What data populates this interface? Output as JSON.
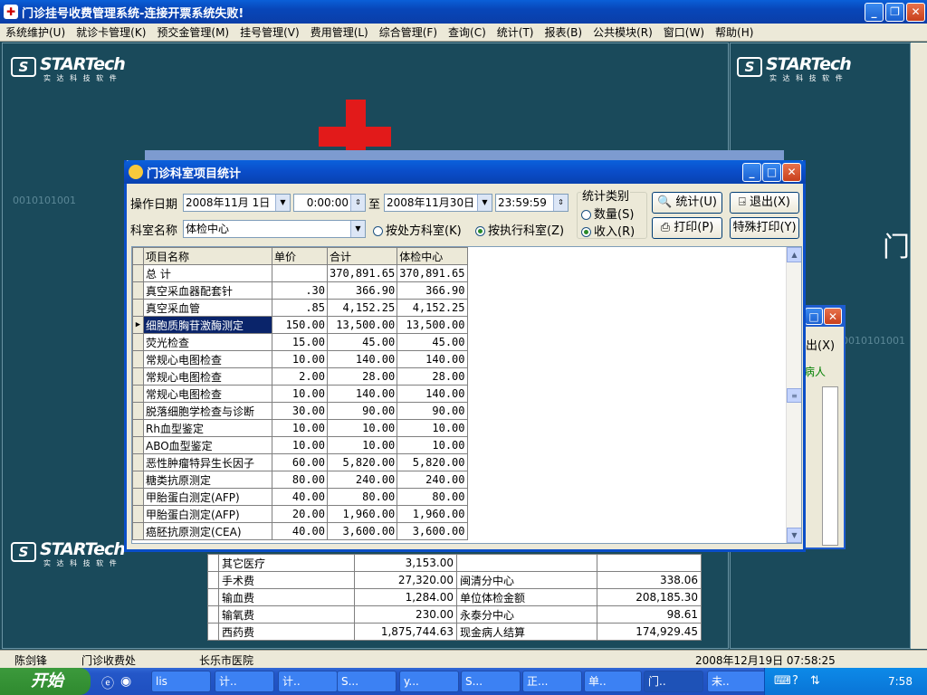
{
  "app": {
    "title": "门诊挂号收费管理系统-连接开票系统失败!",
    "menu": [
      "系统维护(U)",
      "就诊卡管理(K)",
      "预交金管理(M)",
      "挂号管理(V)",
      "费用管理(L)",
      "综合管理(F)",
      "查询(C)",
      "统计(T)",
      "报表(B)",
      "公共模块(R)",
      "窗口(W)",
      "帮助(H)"
    ],
    "logo_text": "STARTech",
    "logo_sub": "实 达 科 技 软 件",
    "bg_text": "门",
    "bg_binary": "0010101001"
  },
  "dialog": {
    "title": "门诊科室项目统计",
    "op_date_label": "操作日期",
    "date_from": "2008年11月 1日",
    "time_from": "0:00:00",
    "to_label": "至",
    "date_to": "2008年11月30日",
    "time_to": "23:59:59",
    "dept_label": "科室名称",
    "dept_value": "体检中心",
    "radio_by_prescribe": "按处方科室(K)",
    "radio_by_execute": "按执行科室(Z)",
    "stat_group_label": "统计类别",
    "radio_quantity": "数量(S)",
    "radio_income": "收入(R)",
    "btn_stat": "统计(U)",
    "btn_exit": "退出(X)",
    "btn_print": "打印(P)",
    "btn_special_print": "特殊打印(Y)"
  },
  "grid": {
    "headers": [
      "项目名称",
      "单价",
      "合计",
      "体检中心"
    ],
    "rows": [
      {
        "name": " 总 计",
        "price": "",
        "total": "370,891.65",
        "dept": "370,891.65"
      },
      {
        "name": "真空采血器配套针",
        "price": ".30",
        "total": "366.90",
        "dept": "366.90"
      },
      {
        "name": "真空采血管",
        "price": ".85",
        "total": "4,152.25",
        "dept": "4,152.25"
      },
      {
        "name": "细胞质胸苷激酶测定",
        "price": "150.00",
        "total": "13,500.00",
        "dept": "13,500.00"
      },
      {
        "name": "荧光检查",
        "price": "15.00",
        "total": "45.00",
        "dept": "45.00"
      },
      {
        "name": "常规心电图检查",
        "price": "10.00",
        "total": "140.00",
        "dept": "140.00"
      },
      {
        "name": "常规心电图检查",
        "price": "2.00",
        "total": "28.00",
        "dept": "28.00"
      },
      {
        "name": "常规心电图检查",
        "price": "10.00",
        "total": "140.00",
        "dept": "140.00"
      },
      {
        "name": "脱落细胞学检查与诊断",
        "price": "30.00",
        "total": "90.00",
        "dept": "90.00"
      },
      {
        "name": "Rh血型鉴定",
        "price": "10.00",
        "total": "10.00",
        "dept": "10.00"
      },
      {
        "name": "ABO血型鉴定",
        "price": "10.00",
        "total": "10.00",
        "dept": "10.00"
      },
      {
        "name": "恶性肿瘤特异生长因子",
        "price": "60.00",
        "total": "5,820.00",
        "dept": "5,820.00"
      },
      {
        "name": "糖类抗原测定",
        "price": "80.00",
        "total": "240.00",
        "dept": "240.00"
      },
      {
        "name": "甲胎蛋白测定(AFP)",
        "price": "40.00",
        "total": "80.00",
        "dept": "80.00"
      },
      {
        "name": "甲胎蛋白测定(AFP)",
        "price": "20.00",
        "total": "1,960.00",
        "dept": "1,960.00"
      },
      {
        "name": "癌胚抗原测定(CEA)",
        "price": "40.00",
        "total": "3,600.00",
        "dept": "3,600.00"
      }
    ]
  },
  "back_window": {
    "exit_label": "出(X)",
    "tab_label": "病人",
    "rows": [
      {
        "a": "其它医疗",
        "b": "3,153.00",
        "c": "",
        "d": ""
      },
      {
        "a": "手术费",
        "b": "27,320.00",
        "c": "闽清分中心",
        "d": "338.06"
      },
      {
        "a": "输血费",
        "b": "1,284.00",
        "c": "单位体检金额",
        "d": "208,185.30"
      },
      {
        "a": "输氧费",
        "b": "230.00",
        "c": "永泰分中心",
        "d": "98.61"
      },
      {
        "a": "西药费",
        "b": "1,875,744.63",
        "c": "现金病人结算",
        "d": "174,929.45"
      }
    ]
  },
  "status": {
    "user": "陈剑锋",
    "station": "门诊收费处",
    "hospital": "长乐市医院",
    "datetime": "2008年12月19日 07:58:25"
  },
  "taskbar": {
    "start": "开始",
    "tasks": [
      "lis",
      "计..",
      "计..",
      "S...",
      "y...",
      "S...",
      "正...",
      "单..",
      "门..",
      "未.."
    ],
    "clock": "7:58"
  }
}
